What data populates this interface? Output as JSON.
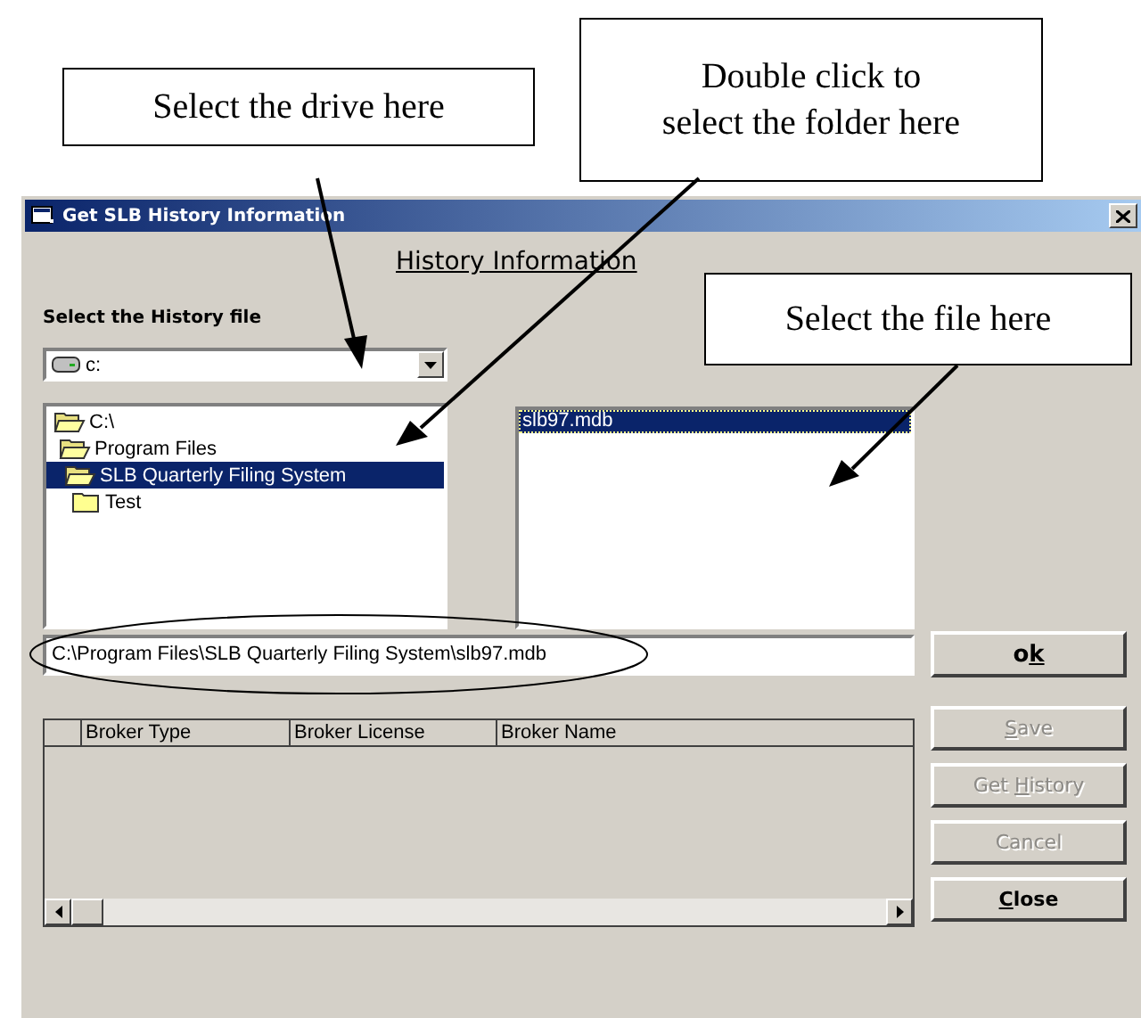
{
  "window": {
    "title": "Get SLB History Information"
  },
  "heading": "History Information",
  "file_label": "Select the History file",
  "drive_combo": {
    "value": "c:"
  },
  "folder_tree": [
    {
      "label": "C:\\",
      "expanded": true,
      "selected": false,
      "children": [
        {
          "label": "Program Files",
          "expanded": true,
          "selected": false,
          "children": [
            {
              "label": "SLB Quarterly Filing System",
              "expanded": true,
              "selected": true,
              "children": [
                {
                  "label": "Test",
                  "expanded": false,
                  "selected": false
                }
              ]
            }
          ]
        }
      ]
    }
  ],
  "file_list": [
    {
      "name": "slb97.mdb",
      "selected": true
    }
  ],
  "path_field": {
    "value": "C:\\Program Files\\SLB Quarterly Filing System\\slb97.mdb"
  },
  "ok_button": {
    "pre": "o",
    "key": "k",
    "disabled": false
  },
  "grid": {
    "columns": [
      "Broker Type",
      "Broker License",
      "Broker Name"
    ]
  },
  "side_buttons": [
    {
      "key": "S",
      "post": "ave",
      "disabled": true
    },
    {
      "pre": "Get ",
      "key": "H",
      "post": "istory",
      "disabled": true
    },
    {
      "post": "Cancel",
      "disabled": true
    },
    {
      "key": "C",
      "post": "lose",
      "disabled": false
    }
  ],
  "annotations": [
    {
      "text": "Select the drive here"
    },
    {
      "text": "Double click to\nselect the folder here"
    },
    {
      "text": "Select the file here"
    }
  ]
}
